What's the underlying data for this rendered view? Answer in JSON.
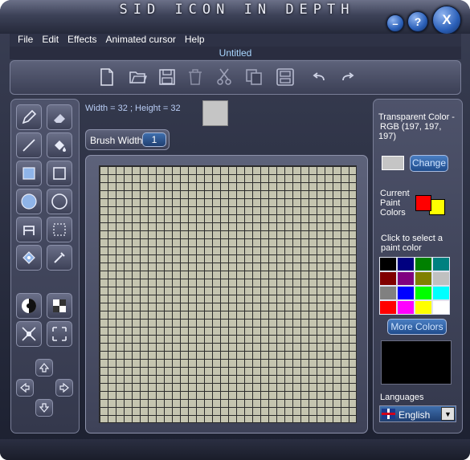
{
  "app": {
    "title": "SID ICON IN DEPTH",
    "document_title": "Untitled"
  },
  "window_controls": {
    "minimize": "–",
    "help": "?",
    "close": "X"
  },
  "menu": [
    "File",
    "Edit",
    "Effects",
    "Animated cursor",
    "Help"
  ],
  "toolbar": {
    "icons": [
      "new-icon",
      "open-icon",
      "save-icon",
      "delete-icon",
      "cut-icon",
      "copy-icon",
      "paste-icon",
      "undo-icon",
      "redo-icon"
    ]
  },
  "left_tools": {
    "icons": [
      "pencil-icon",
      "eraser-icon",
      "line-icon",
      "fill-bucket-icon",
      "filled-rect-icon",
      "rect-icon",
      "filled-ellipse-icon",
      "ellipse-icon",
      "text-icon",
      "select-icon",
      "color-replace-icon",
      "eyedropper-icon",
      "invert-icon",
      "grayscale-icon",
      "shrink-icon",
      "expand-icon",
      "arrow-up-icon",
      "arrow-left-icon",
      "arrow-right-icon",
      "arrow-down-icon"
    ]
  },
  "canvas": {
    "size_text": "Width = 32 ; Height = 32",
    "grid_cells": 32,
    "brush_width_label": "Brush Width",
    "brush_width_value": "1"
  },
  "right_panel": {
    "transparent_line1": "Transparent Color -",
    "transparent_line2": "RGB (197, 197,",
    "transparent_line3": "197)",
    "transparent_color": "#c5c5c5",
    "change_label": "Change",
    "current_line1": "Current",
    "current_line2": "Paint",
    "current_line3": "Colors",
    "foreground_color": "#ff0000",
    "background_color": "#ffff00",
    "click_line1": "Click to select a",
    "click_line2": "paint color",
    "palette": [
      "#000000",
      "#000080",
      "#008000",
      "#008080",
      "#800000",
      "#800080",
      "#808000",
      "#c0c0c0",
      "#808080",
      "#0000ff",
      "#00ff00",
      "#00ffff",
      "#ff0000",
      "#ff00ff",
      "#ffff00",
      "#ffffff"
    ],
    "more_colors_label": "More Colors",
    "languages_label": "Languages",
    "language_value": "English"
  }
}
